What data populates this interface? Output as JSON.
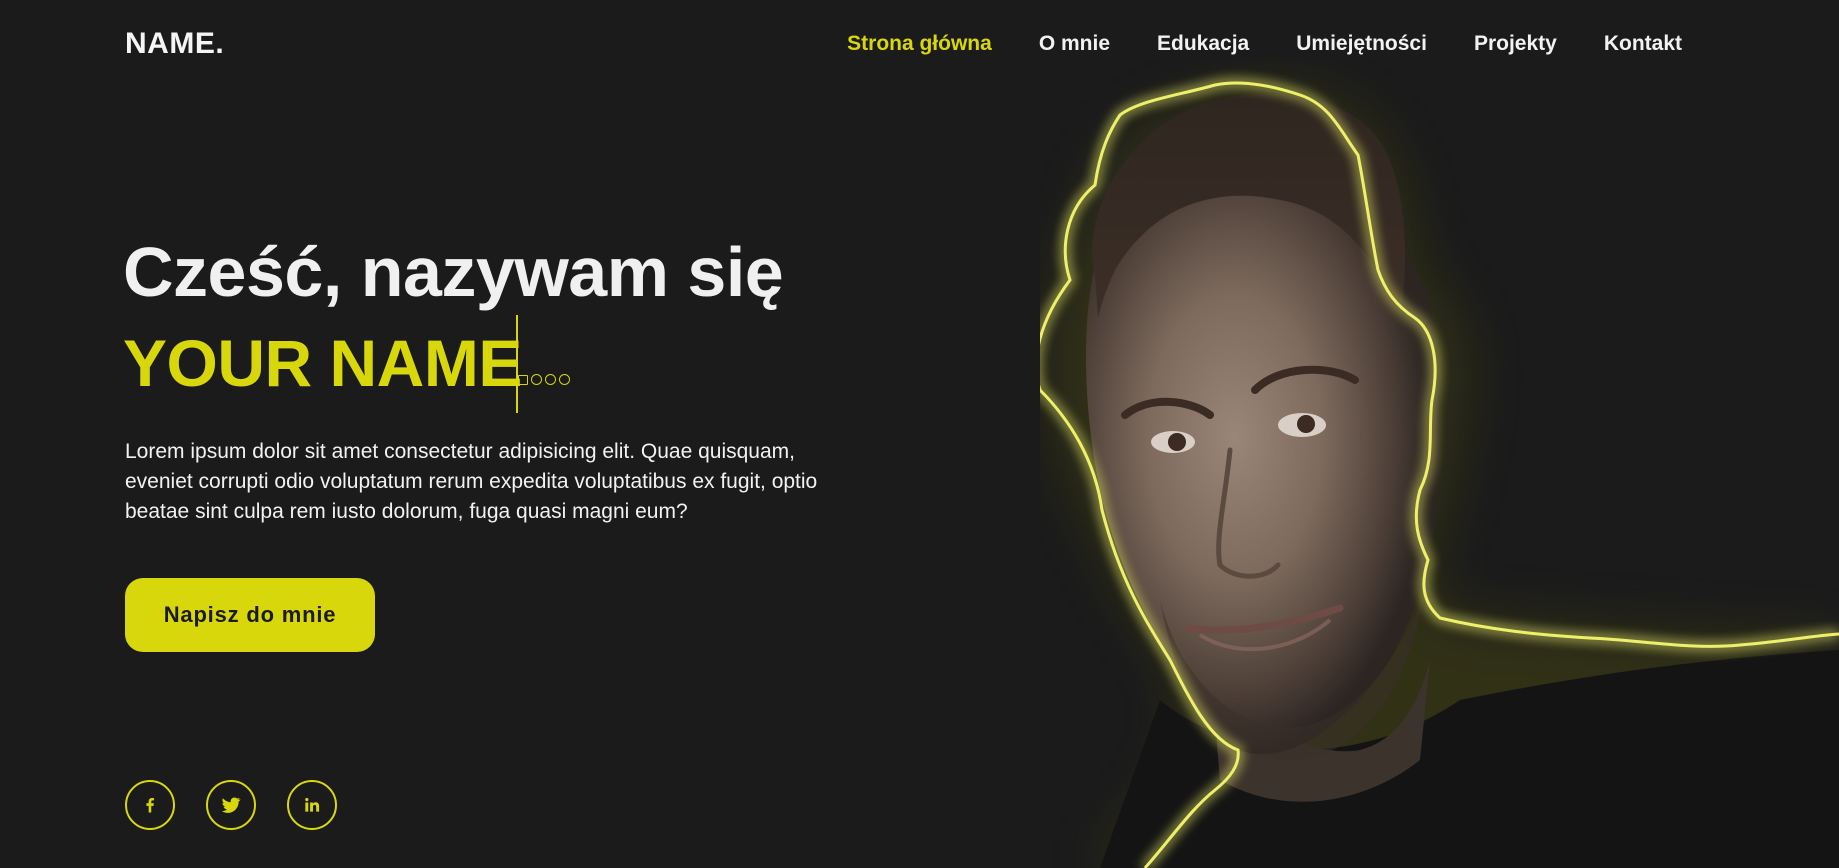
{
  "header": {
    "logo": "NAME.",
    "nav": [
      {
        "label": "Strona główna",
        "active": true
      },
      {
        "label": "O mnie",
        "active": false
      },
      {
        "label": "Edukacja",
        "active": false
      },
      {
        "label": "Umiejętności",
        "active": false
      },
      {
        "label": "Projekty",
        "active": false
      },
      {
        "label": "Kontakt",
        "active": false
      }
    ]
  },
  "hero": {
    "greeting": "Cześć, nazywam się",
    "name": "YOUR NAME",
    "description": "Lorem ipsum dolor sit amet consectetur adipisicing elit. Quae quisquam, eveniet corrupti odio voluptatum rerum expedita voluptatibus ex fugit, optio beatae sint culpa rem iusto dolorum, fuga quasi magni eum?",
    "cta_label": "Napisz do mnie"
  },
  "socials": [
    {
      "icon": "facebook-icon"
    },
    {
      "icon": "twitter-icon"
    },
    {
      "icon": "linkedin-icon"
    }
  ],
  "colors": {
    "background": "#1b1b1c",
    "accent": "#d8d70c",
    "text": "#f2f2f2"
  }
}
